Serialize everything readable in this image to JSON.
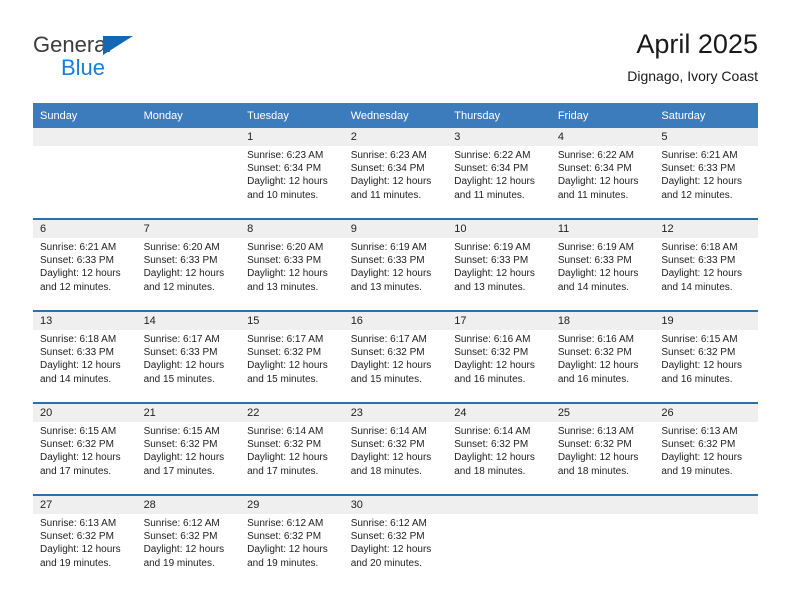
{
  "brand": {
    "name_part1": "General",
    "name_part2": "Blue",
    "triangle_color": "#1268b3",
    "blue_text_color": "#1a7fd4"
  },
  "header": {
    "title": "April 2025",
    "subtitle": "Dignago, Ivory Coast"
  },
  "theme": {
    "header_blue": "#3c7cbd",
    "separator_blue": "#2a6fae",
    "daynum_band_gray": "#efefef",
    "text_color": "#222222"
  },
  "calendar": {
    "weekdays": [
      "Sunday",
      "Monday",
      "Tuesday",
      "Wednesday",
      "Thursday",
      "Friday",
      "Saturday"
    ],
    "weeks": [
      [
        {
          "day": "",
          "lines": []
        },
        {
          "day": "",
          "lines": []
        },
        {
          "day": "1",
          "lines": [
            "Sunrise: 6:23 AM",
            "Sunset: 6:34 PM",
            "Daylight: 12 hours",
            "and 10 minutes."
          ]
        },
        {
          "day": "2",
          "lines": [
            "Sunrise: 6:23 AM",
            "Sunset: 6:34 PM",
            "Daylight: 12 hours",
            "and 11 minutes."
          ]
        },
        {
          "day": "3",
          "lines": [
            "Sunrise: 6:22 AM",
            "Sunset: 6:34 PM",
            "Daylight: 12 hours",
            "and 11 minutes."
          ]
        },
        {
          "day": "4",
          "lines": [
            "Sunrise: 6:22 AM",
            "Sunset: 6:34 PM",
            "Daylight: 12 hours",
            "and 11 minutes."
          ]
        },
        {
          "day": "5",
          "lines": [
            "Sunrise: 6:21 AM",
            "Sunset: 6:33 PM",
            "Daylight: 12 hours",
            "and 12 minutes."
          ]
        }
      ],
      [
        {
          "day": "6",
          "lines": [
            "Sunrise: 6:21 AM",
            "Sunset: 6:33 PM",
            "Daylight: 12 hours",
            "and 12 minutes."
          ]
        },
        {
          "day": "7",
          "lines": [
            "Sunrise: 6:20 AM",
            "Sunset: 6:33 PM",
            "Daylight: 12 hours",
            "and 12 minutes."
          ]
        },
        {
          "day": "8",
          "lines": [
            "Sunrise: 6:20 AM",
            "Sunset: 6:33 PM",
            "Daylight: 12 hours",
            "and 13 minutes."
          ]
        },
        {
          "day": "9",
          "lines": [
            "Sunrise: 6:19 AM",
            "Sunset: 6:33 PM",
            "Daylight: 12 hours",
            "and 13 minutes."
          ]
        },
        {
          "day": "10",
          "lines": [
            "Sunrise: 6:19 AM",
            "Sunset: 6:33 PM",
            "Daylight: 12 hours",
            "and 13 minutes."
          ]
        },
        {
          "day": "11",
          "lines": [
            "Sunrise: 6:19 AM",
            "Sunset: 6:33 PM",
            "Daylight: 12 hours",
            "and 14 minutes."
          ]
        },
        {
          "day": "12",
          "lines": [
            "Sunrise: 6:18 AM",
            "Sunset: 6:33 PM",
            "Daylight: 12 hours",
            "and 14 minutes."
          ]
        }
      ],
      [
        {
          "day": "13",
          "lines": [
            "Sunrise: 6:18 AM",
            "Sunset: 6:33 PM",
            "Daylight: 12 hours",
            "and 14 minutes."
          ]
        },
        {
          "day": "14",
          "lines": [
            "Sunrise: 6:17 AM",
            "Sunset: 6:33 PM",
            "Daylight: 12 hours",
            "and 15 minutes."
          ]
        },
        {
          "day": "15",
          "lines": [
            "Sunrise: 6:17 AM",
            "Sunset: 6:32 PM",
            "Daylight: 12 hours",
            "and 15 minutes."
          ]
        },
        {
          "day": "16",
          "lines": [
            "Sunrise: 6:17 AM",
            "Sunset: 6:32 PM",
            "Daylight: 12 hours",
            "and 15 minutes."
          ]
        },
        {
          "day": "17",
          "lines": [
            "Sunrise: 6:16 AM",
            "Sunset: 6:32 PM",
            "Daylight: 12 hours",
            "and 16 minutes."
          ]
        },
        {
          "day": "18",
          "lines": [
            "Sunrise: 6:16 AM",
            "Sunset: 6:32 PM",
            "Daylight: 12 hours",
            "and 16 minutes."
          ]
        },
        {
          "day": "19",
          "lines": [
            "Sunrise: 6:15 AM",
            "Sunset: 6:32 PM",
            "Daylight: 12 hours",
            "and 16 minutes."
          ]
        }
      ],
      [
        {
          "day": "20",
          "lines": [
            "Sunrise: 6:15 AM",
            "Sunset: 6:32 PM",
            "Daylight: 12 hours",
            "and 17 minutes."
          ]
        },
        {
          "day": "21",
          "lines": [
            "Sunrise: 6:15 AM",
            "Sunset: 6:32 PM",
            "Daylight: 12 hours",
            "and 17 minutes."
          ]
        },
        {
          "day": "22",
          "lines": [
            "Sunrise: 6:14 AM",
            "Sunset: 6:32 PM",
            "Daylight: 12 hours",
            "and 17 minutes."
          ]
        },
        {
          "day": "23",
          "lines": [
            "Sunrise: 6:14 AM",
            "Sunset: 6:32 PM",
            "Daylight: 12 hours",
            "and 18 minutes."
          ]
        },
        {
          "day": "24",
          "lines": [
            "Sunrise: 6:14 AM",
            "Sunset: 6:32 PM",
            "Daylight: 12 hours",
            "and 18 minutes."
          ]
        },
        {
          "day": "25",
          "lines": [
            "Sunrise: 6:13 AM",
            "Sunset: 6:32 PM",
            "Daylight: 12 hours",
            "and 18 minutes."
          ]
        },
        {
          "day": "26",
          "lines": [
            "Sunrise: 6:13 AM",
            "Sunset: 6:32 PM",
            "Daylight: 12 hours",
            "and 19 minutes."
          ]
        }
      ],
      [
        {
          "day": "27",
          "lines": [
            "Sunrise: 6:13 AM",
            "Sunset: 6:32 PM",
            "Daylight: 12 hours",
            "and 19 minutes."
          ]
        },
        {
          "day": "28",
          "lines": [
            "Sunrise: 6:12 AM",
            "Sunset: 6:32 PM",
            "Daylight: 12 hours",
            "and 19 minutes."
          ]
        },
        {
          "day": "29",
          "lines": [
            "Sunrise: 6:12 AM",
            "Sunset: 6:32 PM",
            "Daylight: 12 hours",
            "and 19 minutes."
          ]
        },
        {
          "day": "30",
          "lines": [
            "Sunrise: 6:12 AM",
            "Sunset: 6:32 PM",
            "Daylight: 12 hours",
            "and 20 minutes."
          ]
        },
        {
          "day": "",
          "lines": []
        },
        {
          "day": "",
          "lines": []
        },
        {
          "day": "",
          "lines": []
        }
      ]
    ]
  }
}
